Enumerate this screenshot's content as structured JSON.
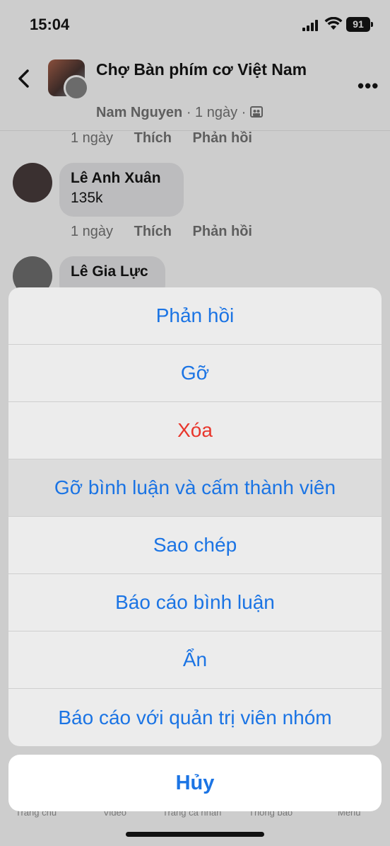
{
  "status": {
    "time": "15:04",
    "battery": "91"
  },
  "header": {
    "title": "Chợ Bàn phím cơ Việt Nam",
    "author": "Nam Nguyen",
    "time_ago": "1 ngày"
  },
  "comments": [
    {
      "time_ago": "1 ngày",
      "like": "Thích",
      "reply": "Phản hồi"
    },
    {
      "name": "Lê Anh Xuân",
      "text": "135k",
      "time_ago": "1 ngày",
      "like": "Thích",
      "reply": "Phản hồi"
    },
    {
      "name": "Lê Gia Lực"
    }
  ],
  "sheet": {
    "items": [
      "Phản hồi",
      "Gỡ",
      "Xóa",
      "Gỡ bình luận và cấm thành viên",
      "Sao chép",
      "Báo cáo bình luận",
      "Ẩn",
      "Báo cáo với quản trị viên nhóm"
    ],
    "cancel": "Hủy"
  },
  "bottom_nav": [
    "Trang chủ",
    "Video",
    "Trang cá nhân",
    "Thông báo",
    "Menu"
  ],
  "colors": {
    "accent": "#1b74e4",
    "destructive": "#e8362c"
  }
}
